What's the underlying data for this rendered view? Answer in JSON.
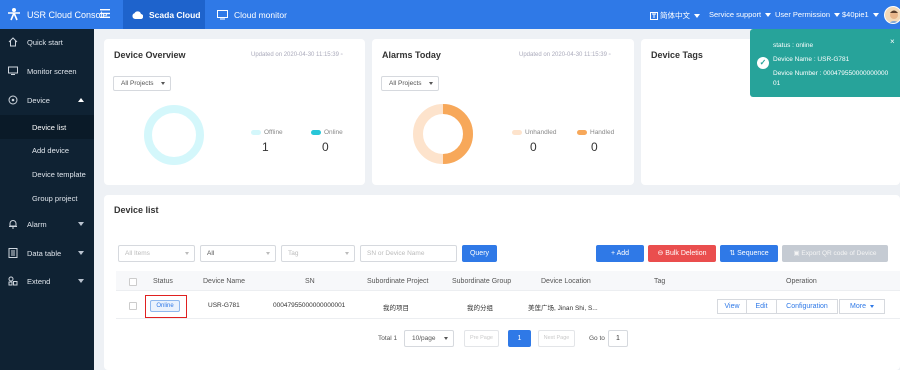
{
  "topbar": {
    "app_title": "USR Cloud Console",
    "tabs": [
      {
        "label": "Scada Cloud",
        "active": true
      },
      {
        "label": "Cloud monitor",
        "active": false
      }
    ],
    "language": "简体中文",
    "service_support": "Service support",
    "user_permission": "User Permission",
    "username": "$40pie1",
    "accent_color": "#2f79e7"
  },
  "sidebar": {
    "items": [
      {
        "label": "Quick start",
        "icon": "home-icon"
      },
      {
        "label": "Monitor screen",
        "icon": "monitor-icon"
      },
      {
        "label": "Device",
        "icon": "device-icon"
      },
      {
        "label": "Device list",
        "sub": true
      },
      {
        "label": "Add device",
        "sub": true
      },
      {
        "label": "Device template",
        "sub": true
      },
      {
        "label": "Group project",
        "sub": true
      },
      {
        "label": "Alarm",
        "icon": "bell-icon"
      },
      {
        "label": "Data table",
        "icon": "table-icon"
      },
      {
        "label": "Extend",
        "icon": "extend-icon"
      }
    ]
  },
  "overview": {
    "title": "Device Overview",
    "updated": "Updated on 2020-04-30 11:15:39",
    "project_select": "All Projects",
    "legend_offline": "Offline",
    "legend_online": "Online",
    "offline_count": "1",
    "online_count": "0"
  },
  "alarms": {
    "title": "Alarms Today",
    "updated": "Updated on 2020-04-30 11:15:39",
    "project_select": "All Projects",
    "legend_unhandled": "Unhandled",
    "legend_handled": "Handled",
    "unhandled_count": "0",
    "handled_count": "0"
  },
  "tags": {
    "title": "Device Tags"
  },
  "notification": {
    "status": "status : online",
    "device_name": "Device Name : USR-G781",
    "device_number_line1": "Device Number : 000479550000000000",
    "device_number_line2": "01",
    "close": "×"
  },
  "device_list": {
    "title": "Device list",
    "filters": {
      "items": "All Items",
      "all": "All",
      "tag": "Tag",
      "search_placeholder": "SN or Device Name"
    },
    "buttons": {
      "query": "Query",
      "add": "+ Add",
      "bulk_delete": "Bulk Deletion",
      "sequence": "Sequence",
      "export_qr": "Export QR code of Device"
    },
    "columns": [
      "Status",
      "Device Name",
      "SN",
      "Subordinate Project",
      "Subordinate Group",
      "Device Location",
      "Tag",
      "Operation"
    ],
    "rows": [
      {
        "status": "Online",
        "device_name": "USR-G781",
        "sn": "00047955000000000001",
        "project": "我的项目",
        "group": "我的分组",
        "location": "美莲广场, Jinan Shi, S...",
        "tag": ""
      }
    ],
    "operations": {
      "view": "View",
      "edit": "Edit",
      "configuration": "Configuration",
      "more": "More"
    },
    "pagination": {
      "total": "Total 1",
      "page_size": "10/page",
      "prev": "Pre Page",
      "current": "1",
      "next": "Next Page",
      "goto_label": "Go to",
      "goto_value": "1"
    }
  }
}
